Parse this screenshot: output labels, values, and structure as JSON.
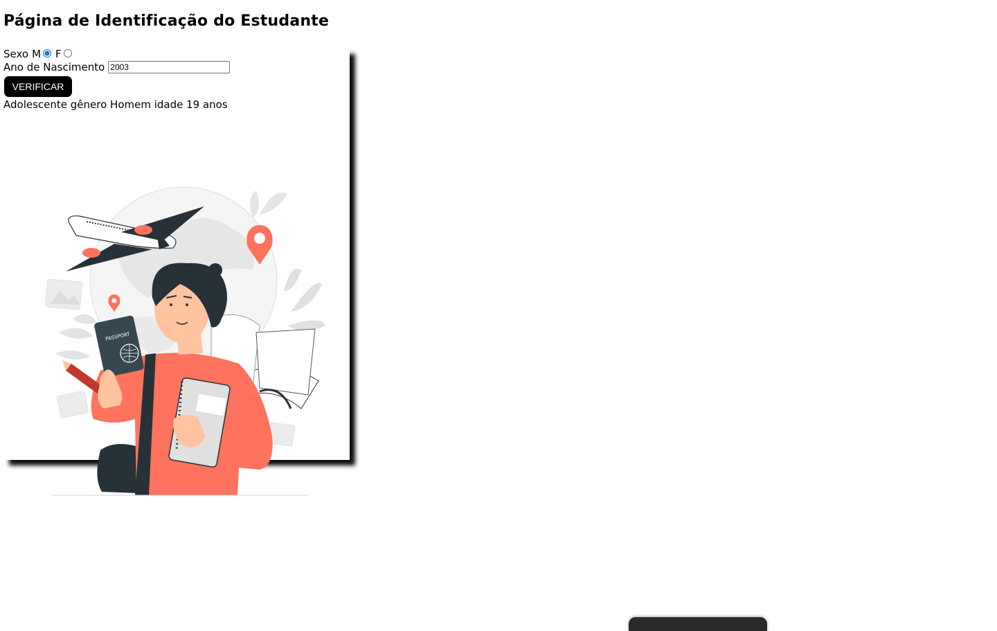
{
  "page": {
    "title": "Página de Identificação do Estudante"
  },
  "form": {
    "sexo_label": "Sexo",
    "option_m_label": "M",
    "option_f_label": "F",
    "selected_sexo": "M",
    "ano_label": "Ano de Nascimento",
    "ano_value": "2003",
    "verify_button_label": "VERIFICAR"
  },
  "result": {
    "text": "Adolescente gênero Homem idade 19 anos"
  },
  "illustration": {
    "icon": "student-traveler-illustration",
    "passport_text": "PASSPORT",
    "colors": {
      "accent": "#ff725e",
      "dark": "#263238",
      "skin": "#ffc3a0",
      "light_gray": "#ebebeb"
    }
  }
}
